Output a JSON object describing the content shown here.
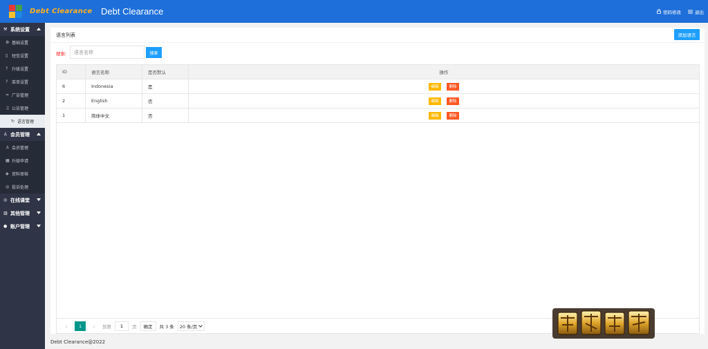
{
  "header": {
    "logo_text": "Debt Clearance",
    "title": "Debt Clearance",
    "change_password": "密码修改",
    "logout": "退出"
  },
  "sidebar": {
    "groups": [
      {
        "label": "系统设置",
        "expanded": true,
        "items": [
          "基础设置",
          "短信设置",
          "升级设置",
          "菜单设置",
          "广告管理",
          "公告管理",
          "语言管理"
        ]
      },
      {
        "label": "会员管理",
        "expanded": true,
        "items": [
          "会员管理",
          "升级申请",
          "资料审核",
          "投诉处理"
        ]
      },
      {
        "label": "在线课堂",
        "expanded": false,
        "items": []
      },
      {
        "label": "其他管理",
        "expanded": false,
        "items": []
      },
      {
        "label": "账户管理",
        "expanded": false,
        "items": []
      }
    ],
    "active_item": "语言管理"
  },
  "panel": {
    "title": "语言列表",
    "add_button": "添加语言",
    "search_label": "搜索:",
    "search_placeholder": "语言名称",
    "search_button": "搜索"
  },
  "table": {
    "columns": [
      "ID",
      "语言名称",
      "是否默认",
      "操作"
    ],
    "rows": [
      {
        "id": "6",
        "name": "Indonesia",
        "default": "是"
      },
      {
        "id": "2",
        "name": "English",
        "default": "否"
      },
      {
        "id": "1",
        "name": "简体中文",
        "default": "否"
      }
    ],
    "edit_label": "编辑",
    "delete_label": "删除"
  },
  "pager": {
    "current_page": "1",
    "goto_label": "到第",
    "goto_value": "1",
    "page_unit": "页",
    "confirm": "确定",
    "total": "共 3 条",
    "page_size": "20 条/页"
  },
  "footer": {
    "text": "Debt Clearance@2022"
  },
  "colors": {
    "header_bg": "#1e6fd9",
    "sidebar_bg": "#2f3546",
    "primary_button": "#1e9fff",
    "edit_button": "#ffb800",
    "delete_button": "#ff5722",
    "page_active": "#009688"
  }
}
